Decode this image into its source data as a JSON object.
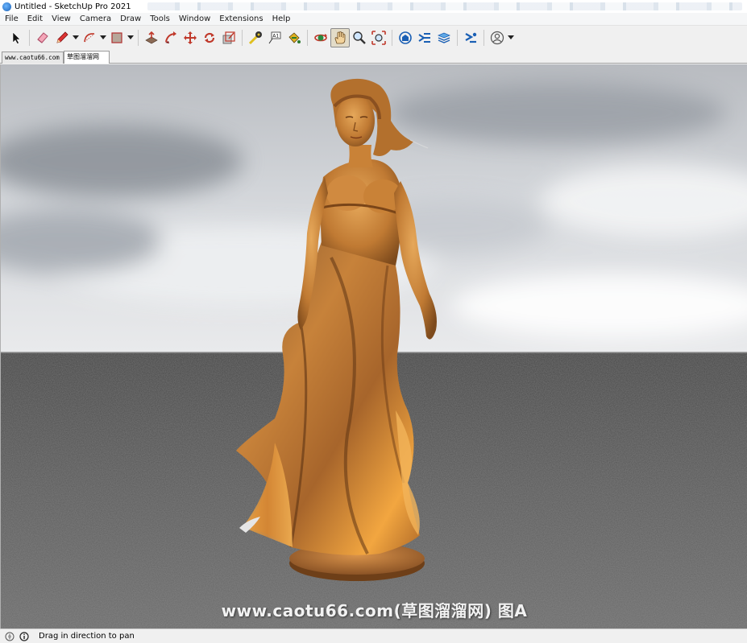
{
  "window": {
    "title": "Untitled - SketchUp Pro 2021"
  },
  "menu": [
    "File",
    "Edit",
    "View",
    "Camera",
    "Draw",
    "Tools",
    "Window",
    "Extensions",
    "Help"
  ],
  "toolbar": {
    "tools": [
      {
        "icon": "select-arrow-icon"
      },
      {
        "icon": "eraser-icon"
      },
      {
        "icon": "pencil-line-icon",
        "dropdown": true
      },
      {
        "icon": "arc-icon",
        "dropdown": true
      },
      {
        "icon": "rectangle-shape-icon",
        "dropdown": true
      },
      {
        "icon": "push-pull-icon"
      },
      {
        "icon": "follow-me-icon"
      },
      {
        "icon": "move-icon"
      },
      {
        "icon": "rotate-icon"
      },
      {
        "icon": "scale-icon"
      },
      {
        "icon": "tape-measure-icon"
      },
      {
        "icon": "text-label-icon"
      },
      {
        "icon": "paint-bucket-icon"
      },
      {
        "icon": "orbit-icon"
      },
      {
        "icon": "pan-hand-icon",
        "active": true
      },
      {
        "icon": "zoom-icon"
      },
      {
        "icon": "zoom-extents-icon"
      },
      {
        "icon": "3d-warehouse-icon"
      },
      {
        "icon": "extension-warehouse-icon"
      },
      {
        "icon": "layout-icon"
      },
      {
        "icon": "extension-manager-icon"
      },
      {
        "icon": "account-icon",
        "dropdown": true
      }
    ]
  },
  "scene_tabs": [
    "www.caotu66.com",
    "草图溜溜网"
  ],
  "viewport": {
    "watermark": "www.caotu66.com(草图溜溜网) 图A",
    "colors": {
      "sky": "#d8dbdf",
      "ground": "#555555",
      "statue": "#c98a3a"
    }
  },
  "statusbar": {
    "message": "Drag in direction to pan"
  }
}
